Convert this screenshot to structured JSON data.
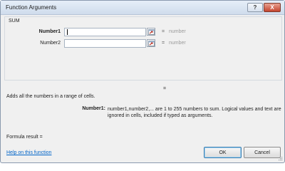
{
  "window": {
    "title": "Function Arguments",
    "help_glyph": "?",
    "close_glyph": "X"
  },
  "function": {
    "name": "SUM",
    "args": [
      {
        "label": "Number1",
        "value": "",
        "equals": "=",
        "result": "number",
        "bold": true
      },
      {
        "label": "Number2",
        "value": "",
        "equals": "=",
        "result": "number",
        "bold": false
      }
    ],
    "result_equals": "=",
    "description": "Adds all the numbers in a range of cells.",
    "arg_help": {
      "name": "Number1:",
      "text": "number1,number2,... are 1 to 255 numbers to sum. Logical values and text are ignored in cells, included if typed as arguments."
    }
  },
  "footer": {
    "formula_result": "Formula result =",
    "help_link": "Help on this function",
    "ok_label": "OK",
    "cancel_label": "Cancel"
  },
  "colors": {
    "link": "#0064c8",
    "close_button": "#c4452f",
    "ok_focus": "#3c7fb1"
  },
  "icons": {
    "collapse": "range-selector-icon",
    "resize": "resize-grip-icon"
  }
}
